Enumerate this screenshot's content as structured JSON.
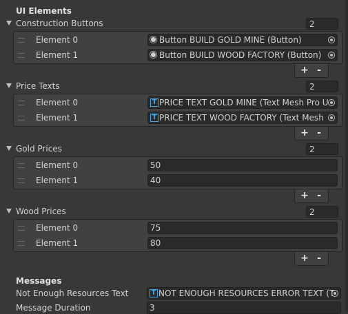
{
  "ui_elements_header": "UI Elements",
  "messages_header": "Messages",
  "construction_buttons": {
    "label": "Construction Buttons",
    "size": "2",
    "items": [
      {
        "label": "Element 0",
        "value": "Button BUILD GOLD MINE (Button)",
        "icon": "button-icon"
      },
      {
        "label": "Element 1",
        "value": "Button BUILD WOOD FACTORY (Button)",
        "icon": "button-icon"
      }
    ]
  },
  "price_texts": {
    "label": "Price Texts",
    "size": "2",
    "items": [
      {
        "label": "Element 0",
        "value": "PRICE TEXT GOLD MINE (Text Mesh Pro U",
        "icon": "textmeshpro-icon"
      },
      {
        "label": "Element 1",
        "value": "PRICE TEXT WOOD FACTORY (Text Mesh",
        "icon": "textmeshpro-icon"
      }
    ]
  },
  "gold_prices": {
    "label": "Gold Prices",
    "size": "2",
    "items": [
      {
        "label": "Element 0",
        "value": "50"
      },
      {
        "label": "Element 1",
        "value": "40"
      }
    ]
  },
  "wood_prices": {
    "label": "Wood Prices",
    "size": "2",
    "items": [
      {
        "label": "Element 0",
        "value": "75"
      },
      {
        "label": "Element 1",
        "value": "80"
      }
    ]
  },
  "list_buttons": {
    "add": "+",
    "remove": "-"
  },
  "tmp_icon_glyph": "T",
  "not_enough_resources": {
    "label": "Not Enough Resources Text",
    "value": "NOT ENOUGH RESOURCES ERROR TEXT (T"
  },
  "message_duration": {
    "label": "Message Duration",
    "value": "3"
  }
}
